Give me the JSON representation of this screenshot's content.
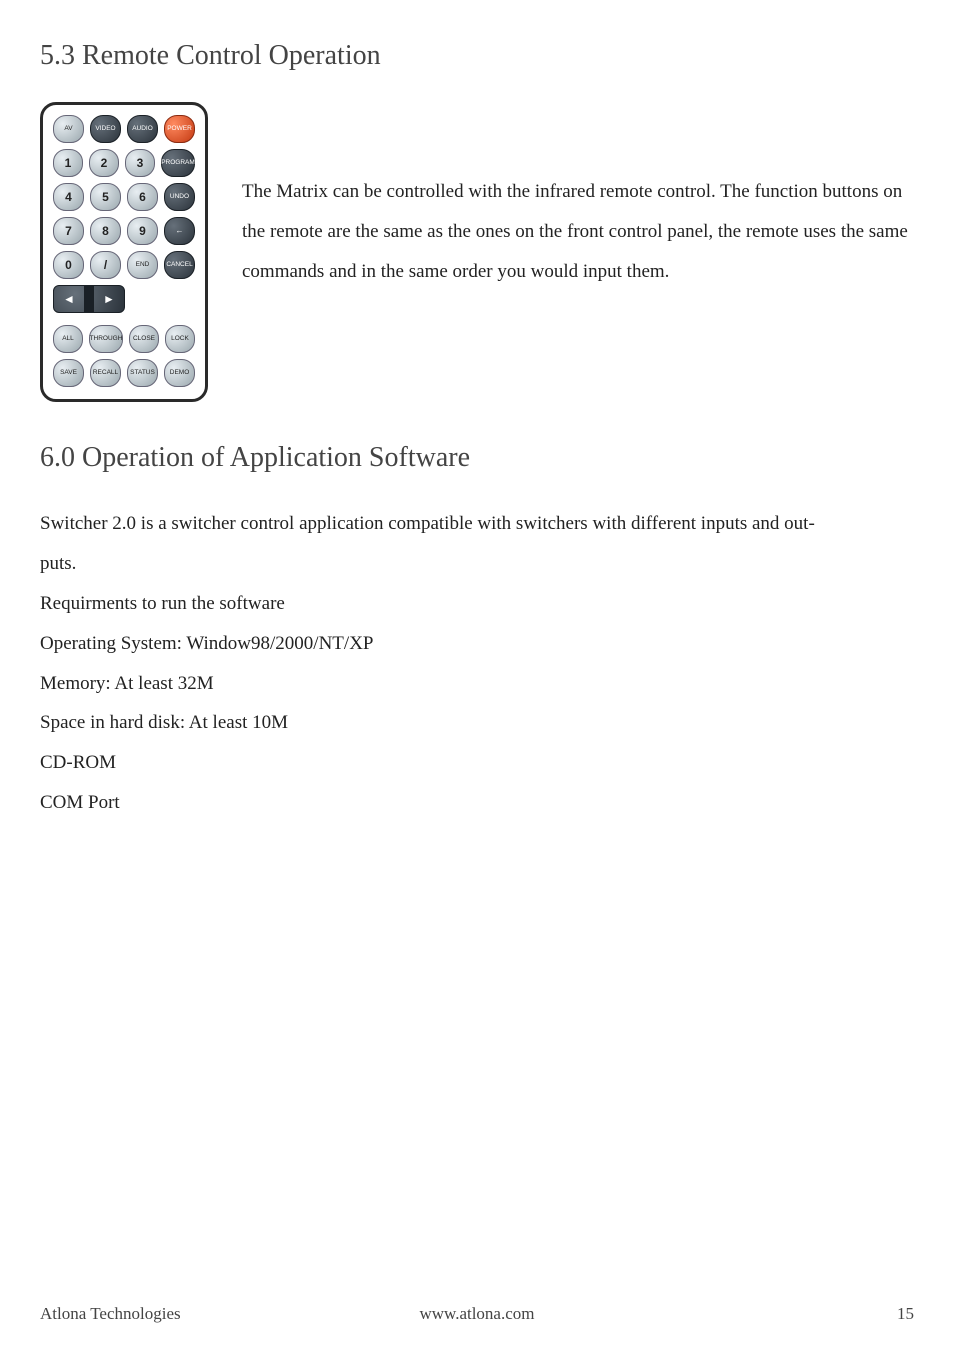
{
  "section_53": {
    "title": "5.3 Remote Control Operation",
    "paragraph": "The Matrix can be controlled with the infrared remote control.  The function buttons on the remote are the same as the ones on the front control panel, the remote uses the same commands and in the same order you would input them."
  },
  "remote": {
    "rows": [
      [
        "AV",
        "VIDEO",
        "AUDIO",
        "POWER"
      ],
      [
        "1",
        "2",
        "3",
        "PROGRAM"
      ],
      [
        "4",
        "5",
        "6",
        "UNDO"
      ],
      [
        "7",
        "8",
        "9",
        "←"
      ],
      [
        "0",
        "/",
        "END",
        "CANCEL"
      ]
    ],
    "arrow_left": "◄",
    "arrow_right": "►",
    "rows_bottom": [
      [
        "ALL",
        "THROUGH",
        "CLOSE",
        "LOCK"
      ],
      [
        "SAVE",
        "RECALL",
        "STATUS",
        "DEMO"
      ]
    ]
  },
  "section_60": {
    "title": "6.0 Operation of Application Software",
    "lines": [
      "Switcher 2.0 is a switcher control application compatible with switchers with different inputs and out-",
      "puts.",
      "Requirments to run the software",
      "Operating System: Window98/2000/NT/XP",
      "Memory: At least 32M",
      "Space in hard disk: At least 10M",
      "CD-ROM",
      "COM Port"
    ]
  },
  "footer": {
    "left": "Atlona Technologies",
    "center": "www.atlona.com",
    "page": "15"
  }
}
